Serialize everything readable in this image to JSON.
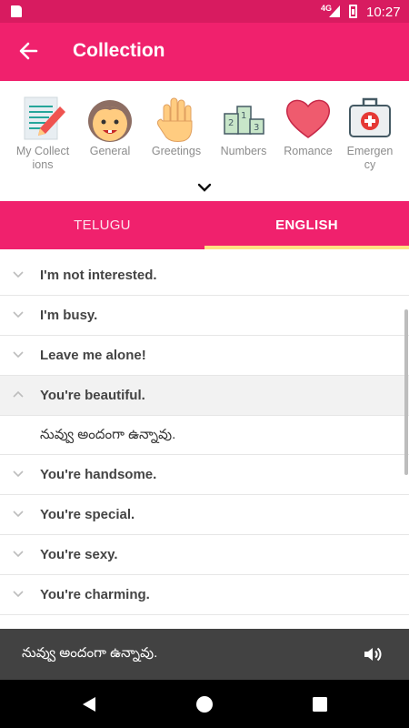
{
  "status_bar": {
    "network": "4G",
    "time": "10:27"
  },
  "app_bar": {
    "title": "Collection",
    "back_icon": "arrow-back-icon"
  },
  "categories": [
    {
      "label": "My Collect\nions",
      "icon": "notepad-pencil-icon"
    },
    {
      "label": "General",
      "icon": "face-icon"
    },
    {
      "label": "Greetings",
      "icon": "waving-hand-icon"
    },
    {
      "label": "Numbers",
      "icon": "podium-icon"
    },
    {
      "label": "Romance",
      "icon": "heart-icon"
    },
    {
      "label": "Emergen\ncy",
      "icon": "first-aid-kit-icon"
    }
  ],
  "tabs": [
    {
      "label": "TELUGU",
      "selected": false
    },
    {
      "label": "ENGLISH",
      "selected": true
    }
  ],
  "phrases": [
    {
      "text": "I'm not interested.",
      "expanded": false
    },
    {
      "text": "I'm busy.",
      "expanded": false
    },
    {
      "text": "Leave me alone!",
      "expanded": false
    },
    {
      "text": "You're beautiful.",
      "expanded": true,
      "translation": "నువ్వు అందంగా ఉన్నావు."
    },
    {
      "text": "You're handsome.",
      "expanded": false
    },
    {
      "text": "You're special.",
      "expanded": false
    },
    {
      "text": "You're sexy.",
      "expanded": false
    },
    {
      "text": "You're charming.",
      "expanded": false
    }
  ],
  "player": {
    "text": "నువ్వు అందంగా ఉన్నావు.",
    "icon": "speaker-icon"
  },
  "colors": {
    "primary": "#f0216d",
    "status_bar": "#d81b60",
    "tab_indicator": "#ffe082",
    "player_bg": "#424242"
  }
}
